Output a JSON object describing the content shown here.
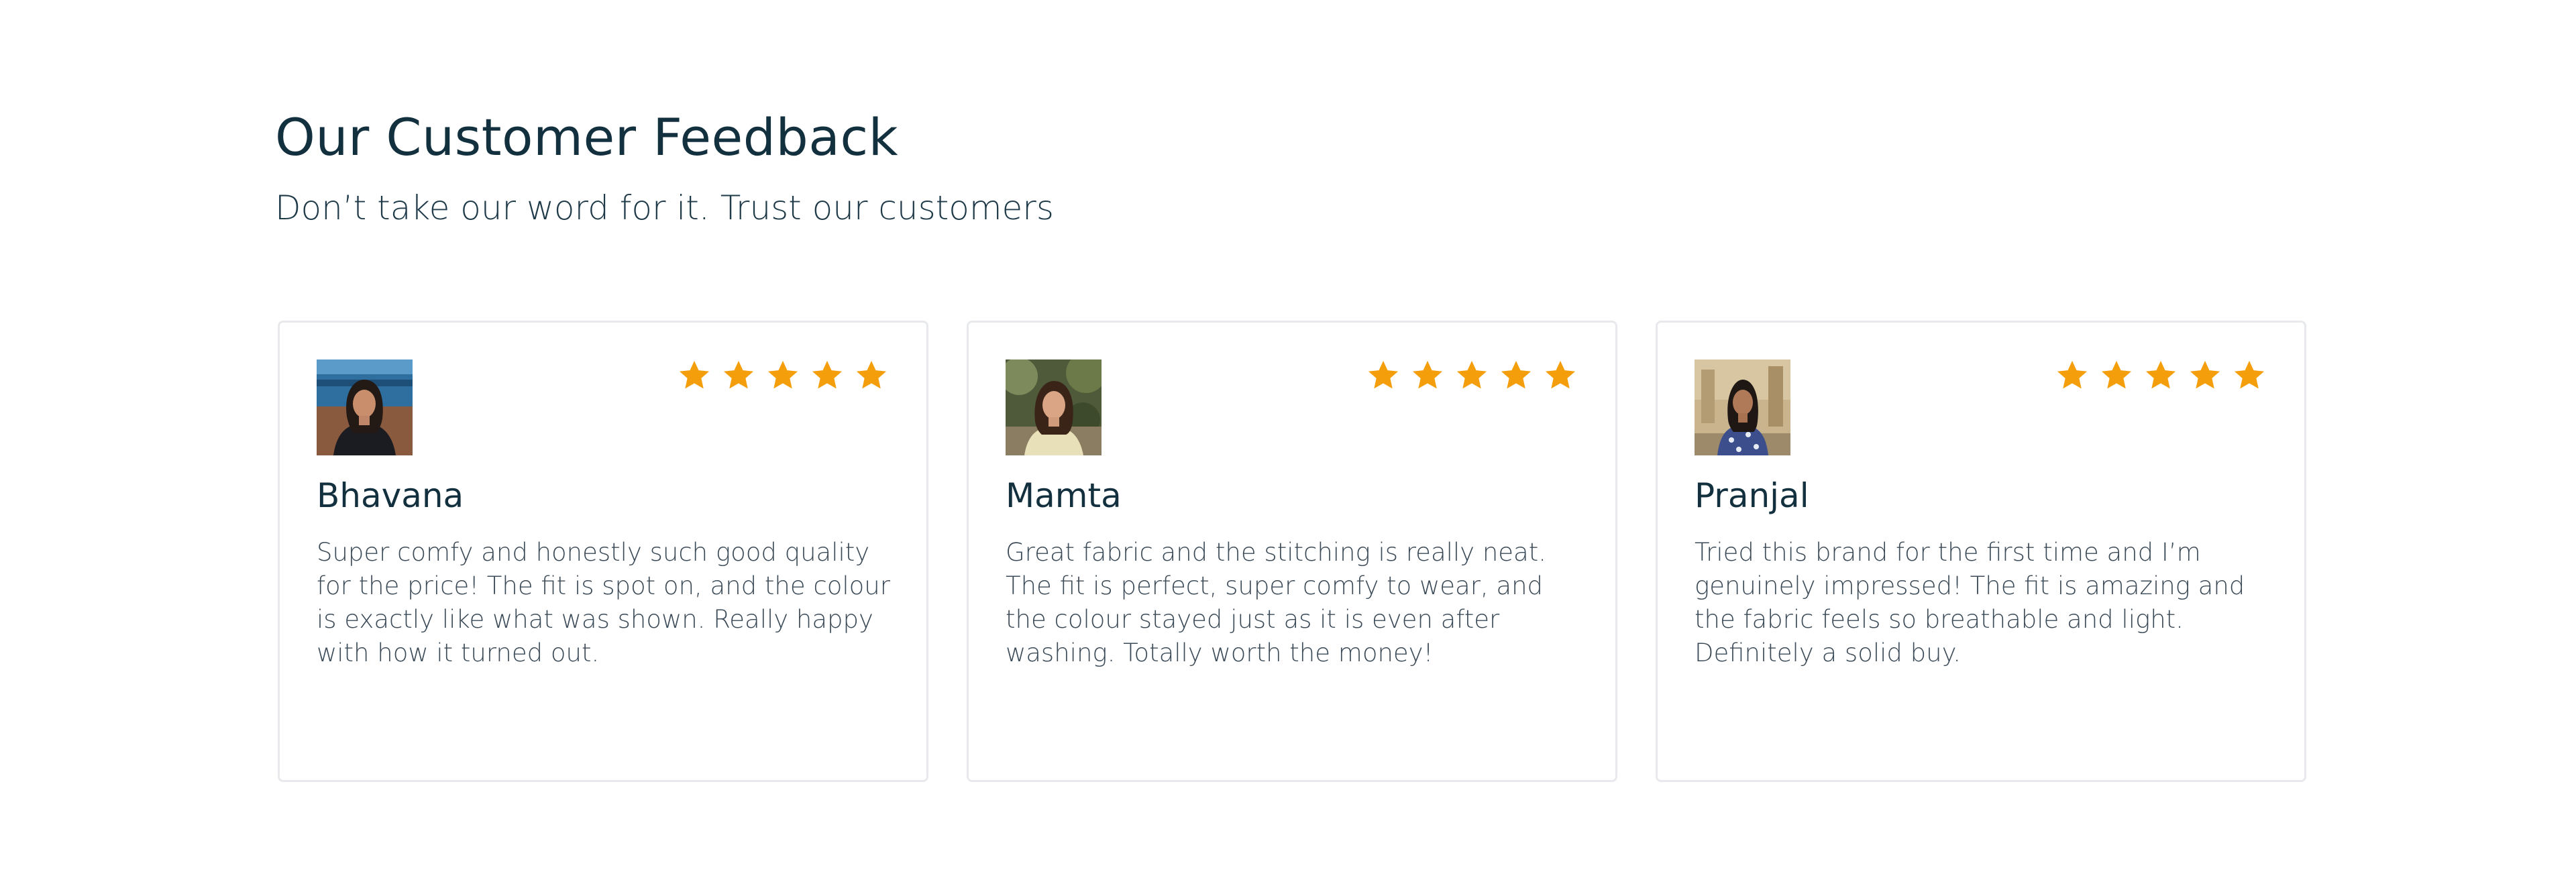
{
  "section": {
    "title": "Our Customer Feedback",
    "subtitle": "Don’t take our word for it. Trust our customers"
  },
  "colors": {
    "heading": "#13303f",
    "body_text": "#3b4a57",
    "star": "#f59e0b",
    "card_border": "#e7e9ec"
  },
  "reviews": [
    {
      "name": "Bhavana",
      "rating": 5,
      "text": "Super comfy and honestly such good quality for the price! The fit is spot on, and the colour is exactly like what was shown. Really happy with how it turned out."
    },
    {
      "name": "Mamta",
      "rating": 5,
      "text": "Great fabric and the stitching is really neat. The fit is perfect, super comfy to wear, and the colour stayed just as it is even after washing. Totally worth the money!"
    },
    {
      "name": "Pranjal",
      "rating": 5,
      "text": "Tried this brand for the first time and I’m genuinely impressed! The fit is amazing and the fabric feels so breathable and light. Definitely a solid buy."
    }
  ]
}
